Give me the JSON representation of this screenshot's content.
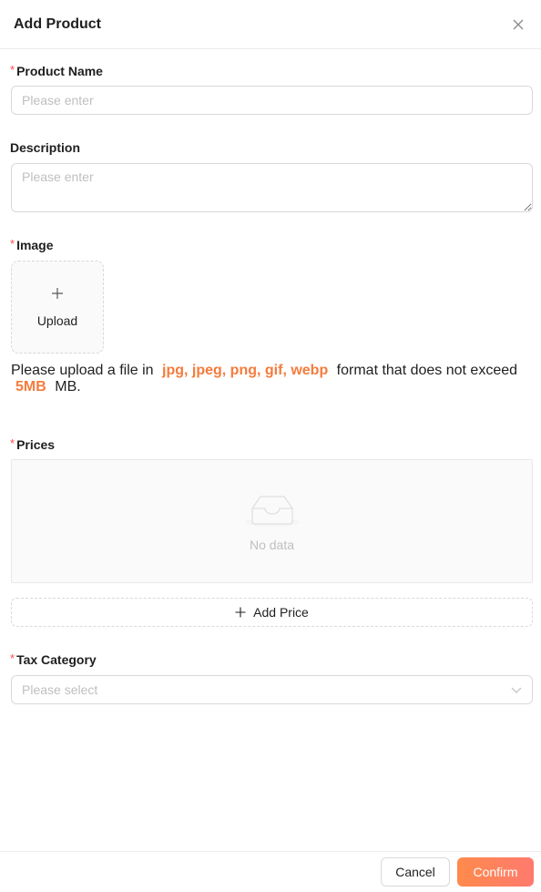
{
  "header": {
    "title": "Add Product"
  },
  "form": {
    "required_mark": "*",
    "product_name": {
      "label": "Product Name",
      "placeholder": "Please enter",
      "value": ""
    },
    "description": {
      "label": "Description",
      "placeholder": "Please enter",
      "value": ""
    },
    "image": {
      "label": "Image",
      "upload_label": "Upload",
      "hint_prefix": "Please upload a file in",
      "formats": "jpg, jpeg, png, gif, webp",
      "hint_middle": "format that does not exceed",
      "max_size": "5MB",
      "hint_suffix": "MB."
    },
    "prices": {
      "label": "Prices",
      "empty_text": "No data",
      "add_label": "Add Price"
    },
    "tax_category": {
      "label": "Tax Category",
      "placeholder": "Please select"
    }
  },
  "footer": {
    "cancel_label": "Cancel",
    "confirm_label": "Confirm"
  },
  "colors": {
    "accent": "#f47c3c",
    "required": "#ff4d4f",
    "confirm_start": "#ff8a4c",
    "confirm_end": "#ff7a6e"
  },
  "icons": {
    "close": "close-icon",
    "upload": "plus-icon",
    "empty": "inbox-icon",
    "add": "plus-icon",
    "select": "chevron-down-icon"
  }
}
